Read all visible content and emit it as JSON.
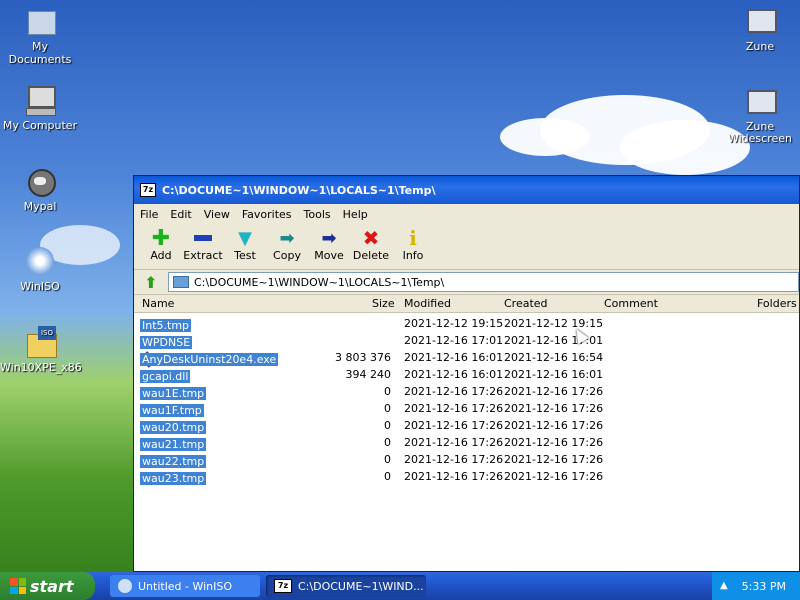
{
  "desktop": {
    "icons_left": [
      {
        "label": "My Documents",
        "icon": "folder-icon"
      },
      {
        "label": "My Computer",
        "icon": "computer-icon"
      },
      {
        "label": "Mypal",
        "icon": "mypal-icon"
      },
      {
        "label": "WinISO",
        "icon": "winiso-icon"
      },
      {
        "label": "Win10XPE_x86",
        "icon": "iso-file-icon"
      }
    ],
    "icons_right": [
      {
        "label": "Zune",
        "icon": "zune-icon"
      },
      {
        "label": "Zune Widescreen",
        "icon": "zune-widescreen-icon"
      }
    ]
  },
  "window": {
    "title": "C:\\DOCUME~1\\WINDOW~1\\LOCALS~1\\Temp\\",
    "app_icon_text": "7z",
    "menu": [
      "File",
      "Edit",
      "View",
      "Favorites",
      "Tools",
      "Help"
    ],
    "toolbar": [
      {
        "label": "Add",
        "icon": "plus-icon",
        "color": "#19b21a"
      },
      {
        "label": "Extract",
        "icon": "minus-icon",
        "color": "#1e3fb5"
      },
      {
        "label": "Test",
        "icon": "check-down-icon",
        "color": "#1fb3c3"
      },
      {
        "label": "Copy",
        "icon": "arrow-right-teal-icon",
        "color": "#1b8a8a"
      },
      {
        "label": "Move",
        "icon": "arrow-right-blue-icon",
        "color": "#1a2f9c"
      },
      {
        "label": "Delete",
        "icon": "x-icon",
        "color": "#e01515"
      },
      {
        "label": "Info",
        "icon": "info-icon",
        "color": "#d4b800"
      }
    ],
    "address": "C:\\DOCUME~1\\WINDOW~1\\LOCALS~1\\Temp\\",
    "columns": {
      "name": "Name",
      "size": "Size",
      "modified": "Modified",
      "created": "Created",
      "comment": "Comment",
      "folders": "Folders"
    },
    "files": [
      {
        "name": "Int5.tmp",
        "size": "",
        "modified": "2021-12-12 19:15",
        "created": "2021-12-12 19:15",
        "icon": "folder-icon"
      },
      {
        "name": "WPDNSE",
        "size": "",
        "modified": "2021-12-16 17:01",
        "created": "2021-12-16 17:01",
        "icon": "folder-icon"
      },
      {
        "name": "AnyDeskUninst20e4.exe",
        "size": "3 803 376",
        "modified": "2021-12-16 16:01",
        "created": "2021-12-16 16:54",
        "icon": "exe-icon"
      },
      {
        "name": "gcapi.dll",
        "size": "394 240",
        "modified": "2021-12-16 16:01",
        "created": "2021-12-16 16:01",
        "icon": "dll-icon"
      },
      {
        "name": "wau1E.tmp",
        "size": "0",
        "modified": "2021-12-16 17:26",
        "created": "2021-12-16 17:26",
        "icon": "folder-icon"
      },
      {
        "name": "wau1F.tmp",
        "size": "0",
        "modified": "2021-12-16 17:26",
        "created": "2021-12-16 17:26",
        "icon": "folder-icon"
      },
      {
        "name": "wau20.tmp",
        "size": "0",
        "modified": "2021-12-16 17:26",
        "created": "2021-12-16 17:26",
        "icon": "folder-icon"
      },
      {
        "name": "wau21.tmp",
        "size": "0",
        "modified": "2021-12-16 17:26",
        "created": "2021-12-16 17:26",
        "icon": "folder-icon"
      },
      {
        "name": "wau22.tmp",
        "size": "0",
        "modified": "2021-12-16 17:26",
        "created": "2021-12-16 17:26",
        "icon": "folder-icon"
      },
      {
        "name": "wau23.tmp",
        "size": "0",
        "modified": "2021-12-16 17:26",
        "created": "2021-12-16 17:26",
        "icon": "folder-icon"
      }
    ]
  },
  "taskbar": {
    "start_label": "start",
    "items": [
      {
        "label": "Untitled - WinISO",
        "icon": "winiso-icon"
      },
      {
        "label": "C:\\DOCUME~1\\WIND...",
        "icon": "7zip-icon",
        "icon_text": "7z"
      }
    ],
    "clock": "5:33 PM"
  }
}
